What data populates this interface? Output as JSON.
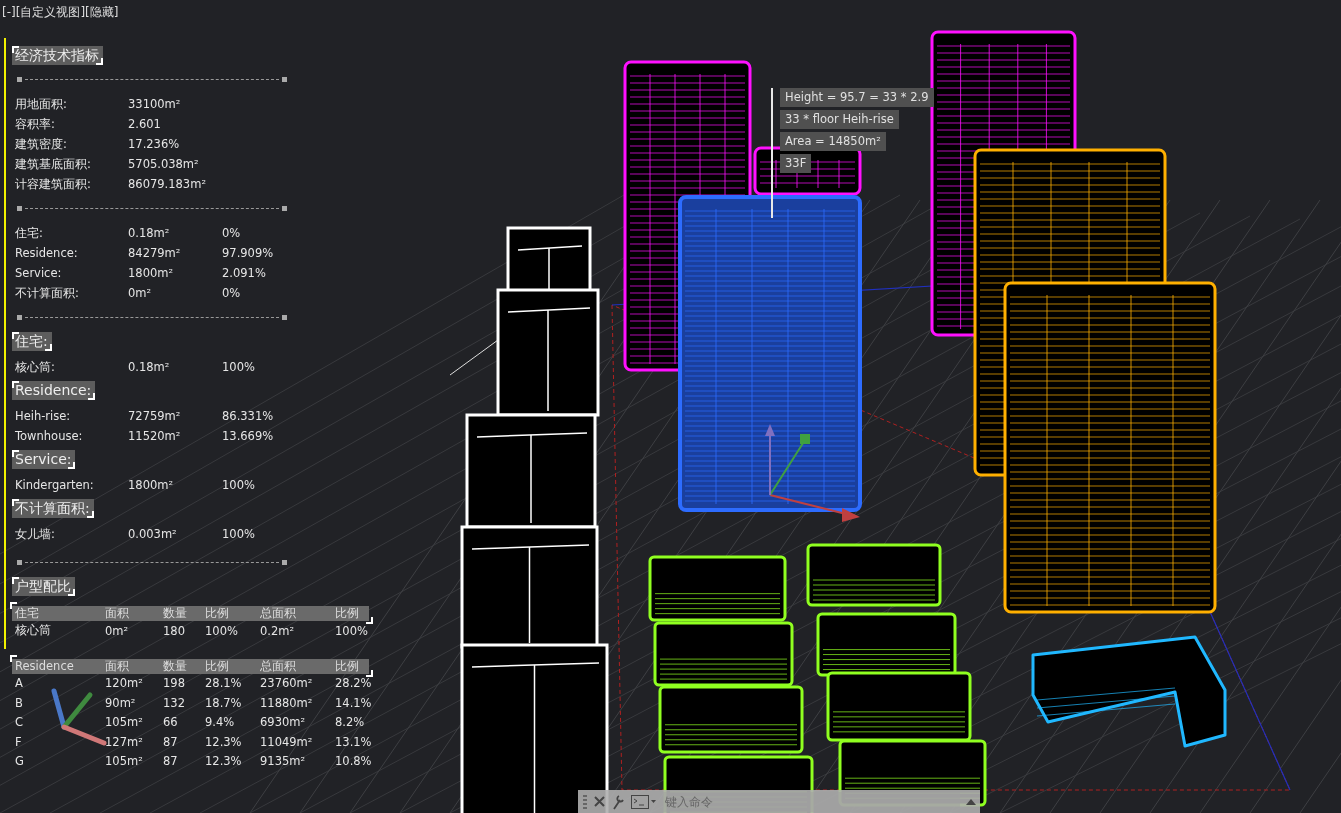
{
  "viewport_label": "[-][自定义视图][隐藏]",
  "indicators": {
    "title": "经济技术指标",
    "summary": [
      {
        "label": "用地面积:",
        "value": "33100m²"
      },
      {
        "label": "容积率:",
        "value": "2.601"
      },
      {
        "label": "建筑密度:",
        "value": "17.236%"
      },
      {
        "label": "建筑基底面积:",
        "value": "5705.038m²"
      },
      {
        "label": "计容建筑面积:",
        "value": "86079.183m²"
      }
    ],
    "usage": [
      {
        "label": "住宅:",
        "value": "0.18m²",
        "share": "0%"
      },
      {
        "label": "Residence:",
        "value": "84279m²",
        "share": "97.909%"
      },
      {
        "label": "Service:",
        "value": "1800m²",
        "share": "2.091%"
      },
      {
        "label": "不计算面积:",
        "value": "0m²",
        "share": "0%"
      }
    ],
    "groups": [
      {
        "title": "住宅:",
        "rows": [
          {
            "label": "核心筒:",
            "value": "0.18m²",
            "share": "100%"
          }
        ]
      },
      {
        "title": "Residence:",
        "rows": [
          {
            "label": "Heih-rise:",
            "value": "72759m²",
            "share": "86.331%"
          },
          {
            "label": "Townhouse:",
            "value": "11520m²",
            "share": "13.669%"
          }
        ]
      },
      {
        "title": "Service:",
        "rows": [
          {
            "label": "Kindergarten:",
            "value": "1800m²",
            "share": "100%"
          }
        ]
      },
      {
        "title": "不计算面积:",
        "rows": [
          {
            "label": "女儿墙:",
            "value": "0.003m²",
            "share": "100%"
          }
        ]
      }
    ]
  },
  "unit_mix": {
    "title": "户型配比",
    "tables": [
      {
        "columns": [
          "住宅",
          "面积",
          "数量",
          "比例",
          "总面积",
          "比例"
        ],
        "rows": [
          [
            "核心筒",
            "0m²",
            "180",
            "100%",
            "0.2m²",
            "100%"
          ]
        ]
      },
      {
        "columns": [
          "Residence",
          "面积",
          "数量",
          "比例",
          "总面积",
          "比例"
        ],
        "rows": [
          [
            "A",
            "120m²",
            "198",
            "28.1%",
            "23760m²",
            "28.2%"
          ],
          [
            "B",
            "90m²",
            "132",
            "18.7%",
            "11880m²",
            "14.1%"
          ],
          [
            "C",
            "105m²",
            "66",
            "9.4%",
            "6930m²",
            "8.2%"
          ],
          [
            "F",
            "127m²",
            "87",
            "12.3%",
            "11049m²",
            "13.1%"
          ],
          [
            "G",
            "105m²",
            "87",
            "12.3%",
            "9135m²",
            "10.8%"
          ]
        ]
      }
    ]
  },
  "tooltip": [
    "Height = 95.7 = 33 * 2.9",
    "33 * floor Heih-rise",
    "Area = 14850m²",
    "33F"
  ],
  "buildings": [
    {
      "kind": "tower",
      "color": "#ff10ff",
      "selected": false
    },
    {
      "kind": "tower",
      "color": "#ff10ff",
      "selected": false
    },
    {
      "kind": "tower",
      "color": "#ff10ff",
      "selected": false
    },
    {
      "kind": "tower",
      "color": "#ffb000",
      "selected": false
    },
    {
      "kind": "tower",
      "color": "#ffb000",
      "selected": false
    },
    {
      "kind": "tower",
      "color": "#2d6cff",
      "selected": true
    },
    {
      "kind": "slab",
      "color": "#ffffff",
      "selected": false
    },
    {
      "kind": "block",
      "color": "#90ff20",
      "selected": false
    },
    {
      "kind": "block",
      "color": "#90ff20",
      "selected": false
    },
    {
      "kind": "block",
      "color": "#90ff20",
      "selected": false
    },
    {
      "kind": "block",
      "color": "#90ff20",
      "selected": false
    },
    {
      "kind": "block",
      "color": "#90ff20",
      "selected": false
    },
    {
      "kind": "block",
      "color": "#90ff20",
      "selected": false
    },
    {
      "kind": "block",
      "color": "#90ff20",
      "selected": false
    },
    {
      "kind": "block",
      "color": "#90ff20",
      "selected": false
    },
    {
      "kind": "lshape",
      "color": "#20b8ff",
      "selected": false
    }
  ],
  "command_line": {
    "placeholder": "键入命令"
  }
}
